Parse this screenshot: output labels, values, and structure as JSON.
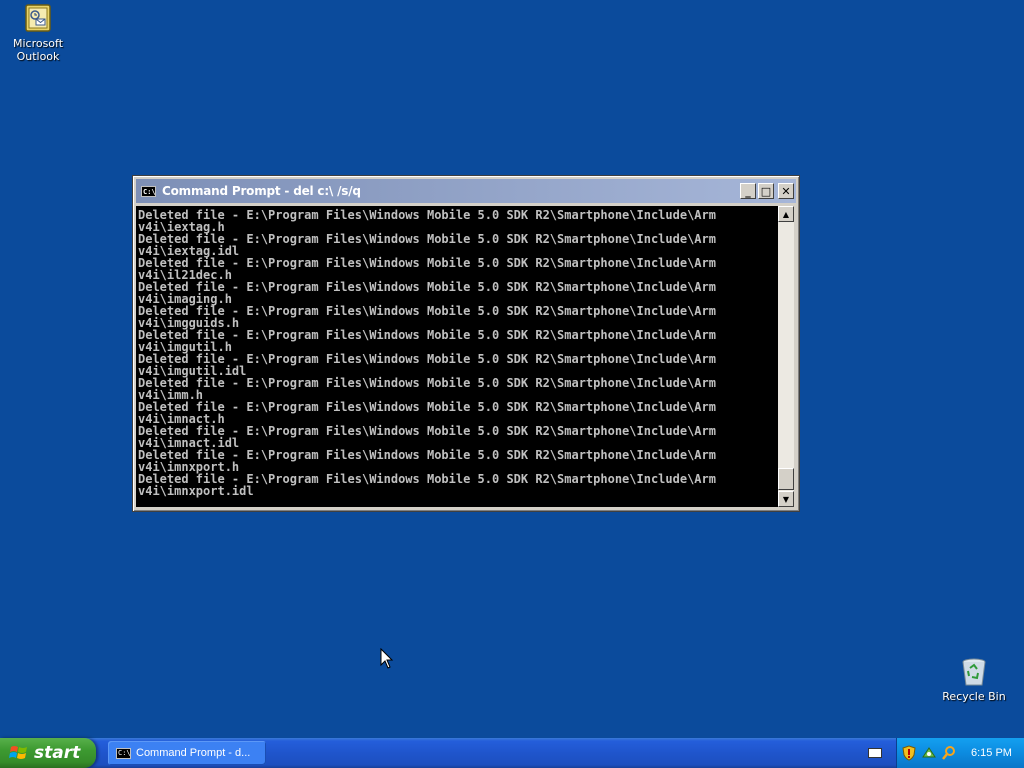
{
  "desktop": {
    "icons": [
      {
        "label": "Microsoft Outlook"
      },
      {
        "label": "Recycle Bin"
      }
    ]
  },
  "window": {
    "title": "Command Prompt - del c:\\ /s/q",
    "console_lines": [
      "Deleted file - E:\\Program Files\\Windows Mobile 5.0 SDK R2\\Smartphone\\Include\\Arm",
      "v4i\\iextag.h",
      "Deleted file - E:\\Program Files\\Windows Mobile 5.0 SDK R2\\Smartphone\\Include\\Arm",
      "v4i\\iextag.idl",
      "Deleted file - E:\\Program Files\\Windows Mobile 5.0 SDK R2\\Smartphone\\Include\\Arm",
      "v4i\\il21dec.h",
      "Deleted file - E:\\Program Files\\Windows Mobile 5.0 SDK R2\\Smartphone\\Include\\Arm",
      "v4i\\imaging.h",
      "Deleted file - E:\\Program Files\\Windows Mobile 5.0 SDK R2\\Smartphone\\Include\\Arm",
      "v4i\\imgguids.h",
      "Deleted file - E:\\Program Files\\Windows Mobile 5.0 SDK R2\\Smartphone\\Include\\Arm",
      "v4i\\imgutil.h",
      "Deleted file - E:\\Program Files\\Windows Mobile 5.0 SDK R2\\Smartphone\\Include\\Arm",
      "v4i\\imgutil.idl",
      "Deleted file - E:\\Program Files\\Windows Mobile 5.0 SDK R2\\Smartphone\\Include\\Arm",
      "v4i\\imm.h",
      "Deleted file - E:\\Program Files\\Windows Mobile 5.0 SDK R2\\Smartphone\\Include\\Arm",
      "v4i\\imnact.h",
      "Deleted file - E:\\Program Files\\Windows Mobile 5.0 SDK R2\\Smartphone\\Include\\Arm",
      "v4i\\imnact.idl",
      "Deleted file - E:\\Program Files\\Windows Mobile 5.0 SDK R2\\Smartphone\\Include\\Arm",
      "v4i\\imnxport.h",
      "Deleted file - E:\\Program Files\\Windows Mobile 5.0 SDK R2\\Smartphone\\Include\\Arm",
      "v4i\\imnxport.idl"
    ],
    "buttons": {
      "minimize": "_",
      "maximize": "□",
      "close": "✕"
    },
    "sysicon_text": "C:\\"
  },
  "taskbar": {
    "start_label": "start",
    "task_item_label": "Command Prompt - d...",
    "clock": "6:15 PM"
  },
  "icons": {
    "outlook": "outlook-icon",
    "recycle": "recycle-bin-icon",
    "tray": [
      "shield-icon",
      "network-icon",
      "search-icon"
    ],
    "keyboard": "keyboard-icon"
  },
  "colors": {
    "desktop": "#0b4b9c",
    "console_bg": "#000000",
    "console_text": "#c0c0c0",
    "title_inactive": "#7d8fb6",
    "start_green": "#3d9a31",
    "taskbar_blue": "#245edb",
    "tray_blue": "#0c8be0"
  }
}
